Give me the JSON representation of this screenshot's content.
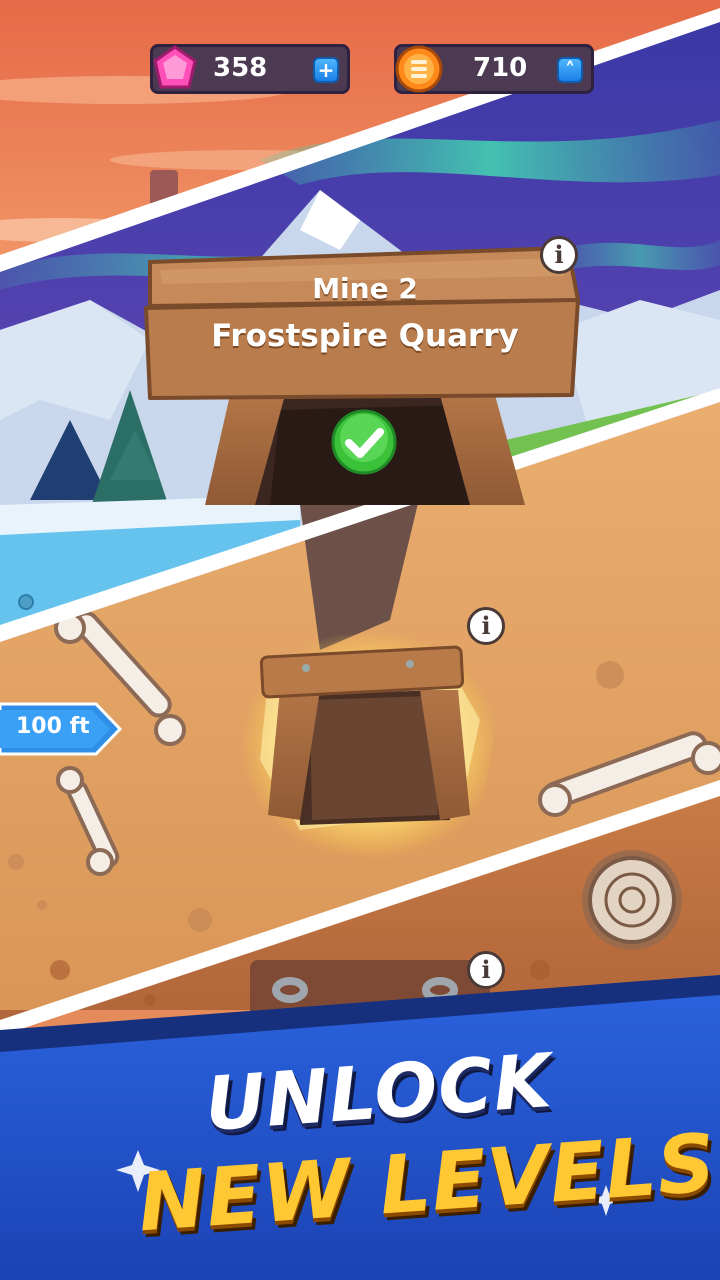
{
  "currency": {
    "gems": "358",
    "coins": "710",
    "gem_add_symbol": "+",
    "coin_add_symbol": "˄"
  },
  "mine": {
    "number_label": "Mine 2",
    "name": "Frostspire Quarry",
    "status": "completed",
    "info_symbol": "i"
  },
  "depth_marker": {
    "label": "100 ft"
  },
  "promo": {
    "line1": "UNLOCK",
    "line2": "NEW LEVELS!"
  },
  "colors": {
    "sky_top": "#e8714a",
    "night_sky": "#3b3aa8",
    "dirt": "#e0a066",
    "deep_dirt": "#c2713f",
    "banner_blue": "#1f4fc4",
    "promo_yellow": "#ffc833",
    "check_green": "#3cc23a"
  }
}
